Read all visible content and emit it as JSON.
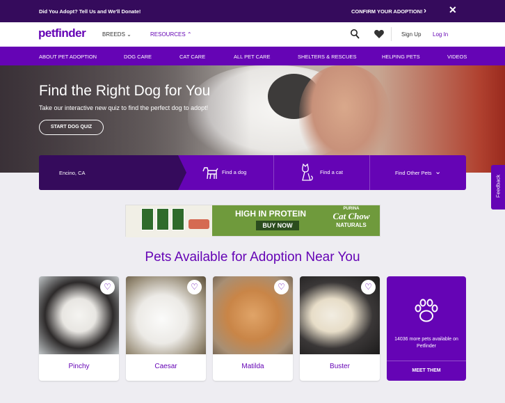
{
  "topbar": {
    "promo_text": "Did You Adopt? Tell Us and We'll Donate!",
    "confirm_label": "CONFIRM YOUR ADOPTION!",
    "close_icon": "close-icon"
  },
  "header": {
    "logo": "petfinder",
    "breeds_label": "BREEDS",
    "resources_label": "RESOURCES",
    "signup_label": "Sign Up",
    "login_label": "Log In"
  },
  "subnav": {
    "items": [
      "ABOUT PET ADOPTION",
      "DOG CARE",
      "CAT CARE",
      "ALL PET CARE",
      "SHELTERS & RESCUES",
      "HELPING PETS",
      "VIDEOS"
    ]
  },
  "hero": {
    "title": "Find the Right Dog for You",
    "subtitle": "Take our interactive new quiz to find the perfect dog to adopt!",
    "button_label": "START DOG QUIZ"
  },
  "search": {
    "location": "Encino, CA",
    "find_dog": "Find a dog",
    "find_cat": "Find a cat",
    "find_other": "Find Other Pets"
  },
  "ad": {
    "headline": "HIGH IN PROTEIN",
    "button": "BUY NOW",
    "brand_top": "PURINA",
    "brand_main": "Cat Chow",
    "brand_sub": "NATURALS"
  },
  "section": {
    "title": "Pets Available for Adoption Near You"
  },
  "pets": [
    {
      "name": "Pinchy"
    },
    {
      "name": "Caesar"
    },
    {
      "name": "Matilda"
    },
    {
      "name": "Buster"
    }
  ],
  "more": {
    "text": "14036 more pets available on Petfinder",
    "cta": "MEET THEM"
  },
  "feedback": {
    "label": "Feedback"
  },
  "colors": {
    "brand": "#6504b5",
    "dark": "#350b5c",
    "background": "#eeedf2"
  }
}
